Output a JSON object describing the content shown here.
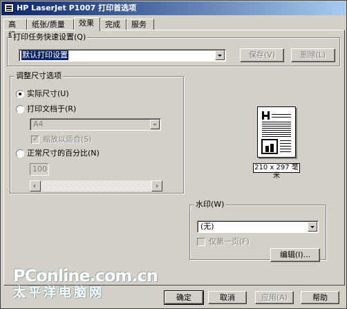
{
  "window": {
    "title": "HP LaserJet P1007 打印首选项",
    "icon": "printer-icon"
  },
  "tabs": [
    {
      "label": "高级"
    },
    {
      "label": "纸张/质量"
    },
    {
      "label": "效果"
    },
    {
      "label": "完成"
    },
    {
      "label": "服务"
    }
  ],
  "active_tab": "效果",
  "quick_sets": {
    "group_label": "打印任务快速设置(Q)",
    "selected": "默认打印设置",
    "save_label": "保存(V)",
    "delete_label": "删除(L)"
  },
  "resize": {
    "group_label": "调整尺寸选项",
    "actual_size_label": "实际尺寸(U)",
    "print_on_label": "打印文档于(R)",
    "paper_value": "A4",
    "scale_to_fit_label": "缩放以适合(S)",
    "percent_label": "正常尺寸的百分比(N)",
    "percent_value": "100",
    "selected_option": "实际尺寸(U)"
  },
  "preview": {
    "size_label": "210 x 297 毫米"
  },
  "watermark": {
    "group_label": "水印(W)",
    "selected": "(无)",
    "first_page_only_label": "仅第一页(F)",
    "edit_label": "编辑(I)..."
  },
  "footer": {
    "ok_label": "确定",
    "cancel_label": "取消",
    "apply_label": "应用(A)",
    "help_label": "帮助"
  },
  "overlay_logo": {
    "line1": "PConline.com.cn",
    "line2": "太平洋电脑网"
  }
}
